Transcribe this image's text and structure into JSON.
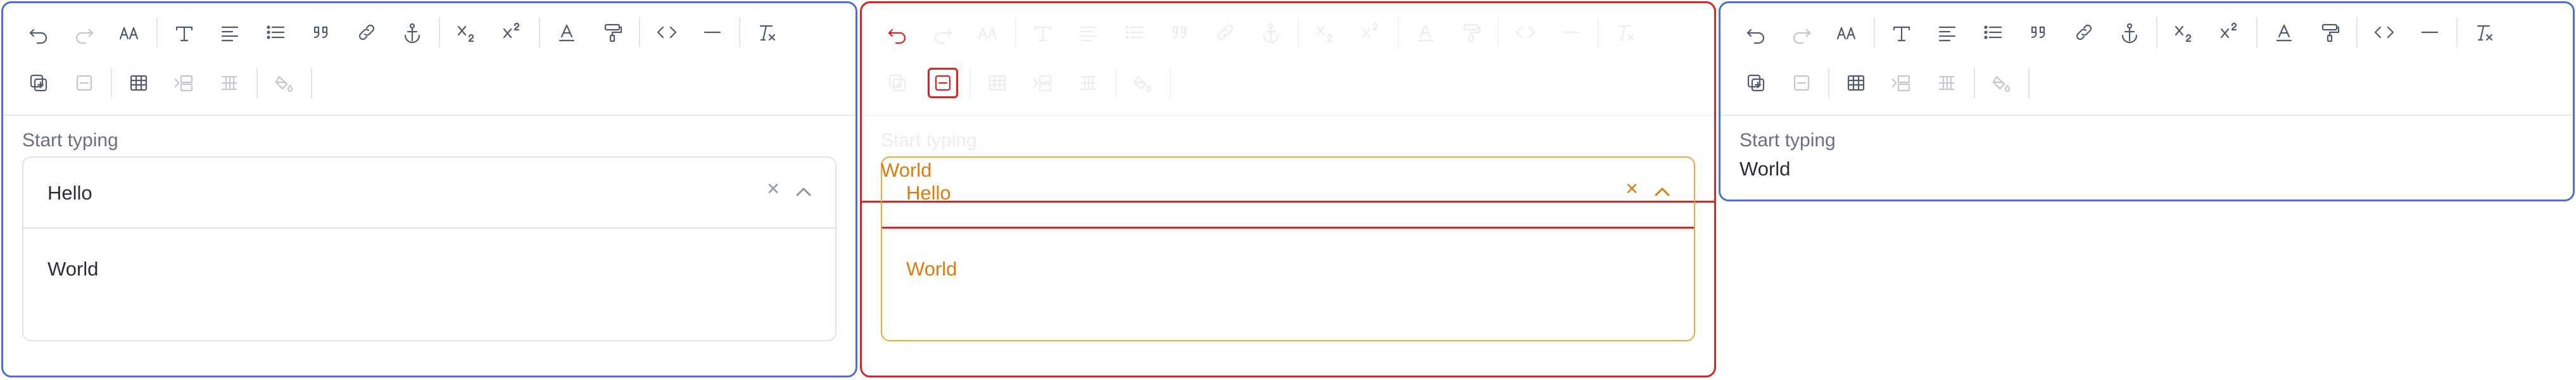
{
  "colors": {
    "panel_border_blue": "#4a6fd6",
    "highlight_red": "#dd2222",
    "highlight_orange": "#e07a0c",
    "icon_default": "#525a6e"
  },
  "toolbar": {
    "row1": [
      "undo-icon",
      "redo-icon",
      "font-size-icon",
      "heading-icon",
      "align-left-icon",
      "bullet-list-icon",
      "blockquote-icon",
      "link-icon",
      "anchor-icon",
      "subscript-icon",
      "superscript-icon",
      "text-color-icon",
      "format-painter-icon",
      "code-icon",
      "horizontal-rule-icon",
      "clear-format-icon"
    ],
    "row2": [
      "insert-row-icon",
      "delete-row-icon",
      "table-icon",
      "insert-column-icon",
      "table-grid-icon",
      "fill-color-icon"
    ]
  },
  "panels": {
    "left": {
      "field_label": "Start typing",
      "summary_value": "Hello",
      "clear_symbol": "×",
      "body_value": "World"
    },
    "middle": {
      "field_label": "Start typing",
      "floating_value": "World",
      "summary_value": "Hello",
      "clear_symbol": "×",
      "body_value": "World"
    },
    "right": {
      "field_label": "Start typing",
      "value": "World"
    }
  }
}
